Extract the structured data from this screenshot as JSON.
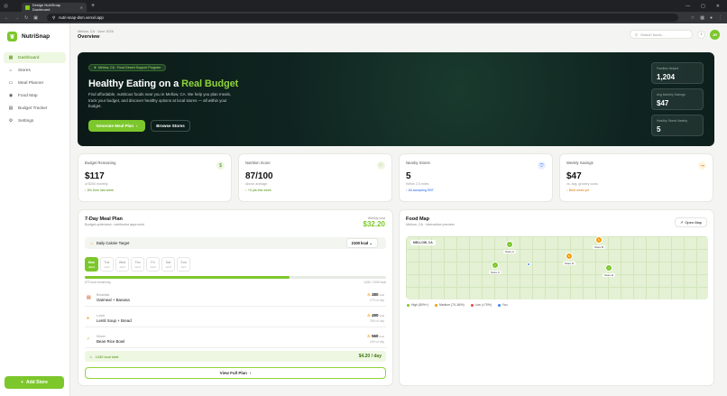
{
  "browser": {
    "tab_title": "Design NutriSnap Dashboard",
    "url": "nutri-snap-dsm.vercel.app"
  },
  "sidebar": {
    "brand": "NutriSnap",
    "items": [
      {
        "label": "Dashboard",
        "icon": "grid-icon"
      },
      {
        "label": "Stores",
        "icon": "store-icon"
      },
      {
        "label": "Meal Planner",
        "icon": "calendar-icon"
      },
      {
        "label": "Food Map",
        "icon": "map-pin-icon"
      },
      {
        "label": "Budget Tracker",
        "icon": "wallet-icon"
      },
      {
        "label": "Settings",
        "icon": "gear-icon"
      }
    ],
    "add_store": "Add Store"
  },
  "header": {
    "breadcrumb": "Mellow, CA · June 2026",
    "title": "Overview",
    "search_placeholder": "Search foods...",
    "avatar": "JR"
  },
  "hero": {
    "pill": "Mellow, CA · Food Desert Support Program",
    "title_a": "Healthy Eating on a ",
    "title_b": "Real Budget",
    "description": "Find affordable, nutritious foods near you in Mellow, CA. We help you plan meals, track your budget, and discover healthy options at local stores — all within your budget.",
    "primary_btn": "Generate Meal Plan",
    "secondary_btn": "Browse Stores",
    "stats": [
      {
        "label": "Families Helped",
        "value": "1,204"
      },
      {
        "label": "Avg Monthly Savings",
        "value": "$47"
      },
      {
        "label": "Healthy Stores Nearby",
        "value": "5"
      }
    ]
  },
  "cards": [
    {
      "label": "Budget Remaining",
      "value": "$117",
      "sub": "of $250 monthly",
      "trend": "↑ 8% from last week",
      "trend_color": "#4d8f12",
      "icon": "$",
      "icon_bg": "#eef7e2",
      "icon_color": "#4d8f12"
    },
    {
      "label": "Nutrition Score",
      "value": "87/100",
      "sub": "Above average",
      "trend": "↑ +5 pts this week",
      "trend_color": "#4d8f12",
      "icon": "♡",
      "icon_bg": "#eef7e2",
      "icon_color": "#4d8f12"
    },
    {
      "label": "Nearby Stores",
      "value": "5",
      "sub": "Within 2.5 miles",
      "trend": "↑ All accepting EBT",
      "trend_color": "#2563eb",
      "icon": "⛉",
      "icon_bg": "#e8f0fe",
      "icon_color": "#2563eb"
    },
    {
      "label": "Weekly Savings",
      "value": "$47",
      "sub": "vs. avg. grocery costs",
      "trend": "↑ Best week yet",
      "trend_color": "#d97706",
      "icon": "↝",
      "icon_bg": "#fff4e0",
      "icon_color": "#d97706"
    }
  ],
  "meal": {
    "title": "7-Day Meal Plan",
    "subtitle": "Budget-optimized, nutritionist approved",
    "weekly_label": "Weekly cost",
    "weekly_value": "$32.20",
    "target_label": "Daily Calorie Target",
    "target_value": "2100 kcal",
    "days": [
      {
        "d": "Mon",
        "n": "Jun1"
      },
      {
        "d": "Tue",
        "n": "Jun2"
      },
      {
        "d": "Wed",
        "n": "Jun3"
      },
      {
        "d": "Thu",
        "n": "Jun4"
      },
      {
        "d": "Fri",
        "n": "Jun5"
      },
      {
        "d": "Sat",
        "n": "Jun6"
      },
      {
        "d": "Sun",
        "n": "Jun7"
      }
    ],
    "progress_fraction": 0.68,
    "remaining": "670 kcal remaining",
    "consumed": "1430 / 2100 kcal",
    "rows": [
      {
        "kind": "Breakfast",
        "food": "Oatmeal + Banana",
        "kcal": "380",
        "unit": "kcal",
        "pct": "27% of day",
        "icon": "▤",
        "icon_color": "#c2410c"
      },
      {
        "kind": "Lunch",
        "food": "Lentil Soup + Bread",
        "kcal": "490",
        "unit": "kcal",
        "pct": "35% of day",
        "icon": "●",
        "icon_color": "#f59e0b"
      },
      {
        "kind": "Dinner",
        "food": "Bean Rice Bowl",
        "kcal": "560",
        "unit": "kcal",
        "pct": "40% of day",
        "icon": "✓",
        "icon_color": "#7cc72b"
      }
    ],
    "total_label": "1430 kcal total",
    "total_value": "$4.20 / day",
    "view_full": "View Full Plan"
  },
  "map": {
    "title": "Food Map",
    "subtitle": "Mellow, CA · interactive preview",
    "open_map": "Open Map",
    "region_label": "MELLOW, CA",
    "pins": [
      {
        "label": "Store A",
        "color": "#7cc72b"
      },
      {
        "label": "Store B",
        "color": "#f59e0b"
      },
      {
        "label": "Store C",
        "color": "#7cc72b"
      },
      {
        "label": "Store D",
        "color": "#f59e0b"
      },
      {
        "label": "Store E",
        "color": "#7cc72b"
      }
    ],
    "legend": [
      {
        "label": "High (80%+)",
        "color": "#7cc72b"
      },
      {
        "label": "Medium (70–84%)",
        "color": "#f59e0b"
      },
      {
        "label": "Low (<70%)",
        "color": "#ef4444"
      },
      {
        "label": "You",
        "color": "#3b82f6"
      }
    ]
  }
}
